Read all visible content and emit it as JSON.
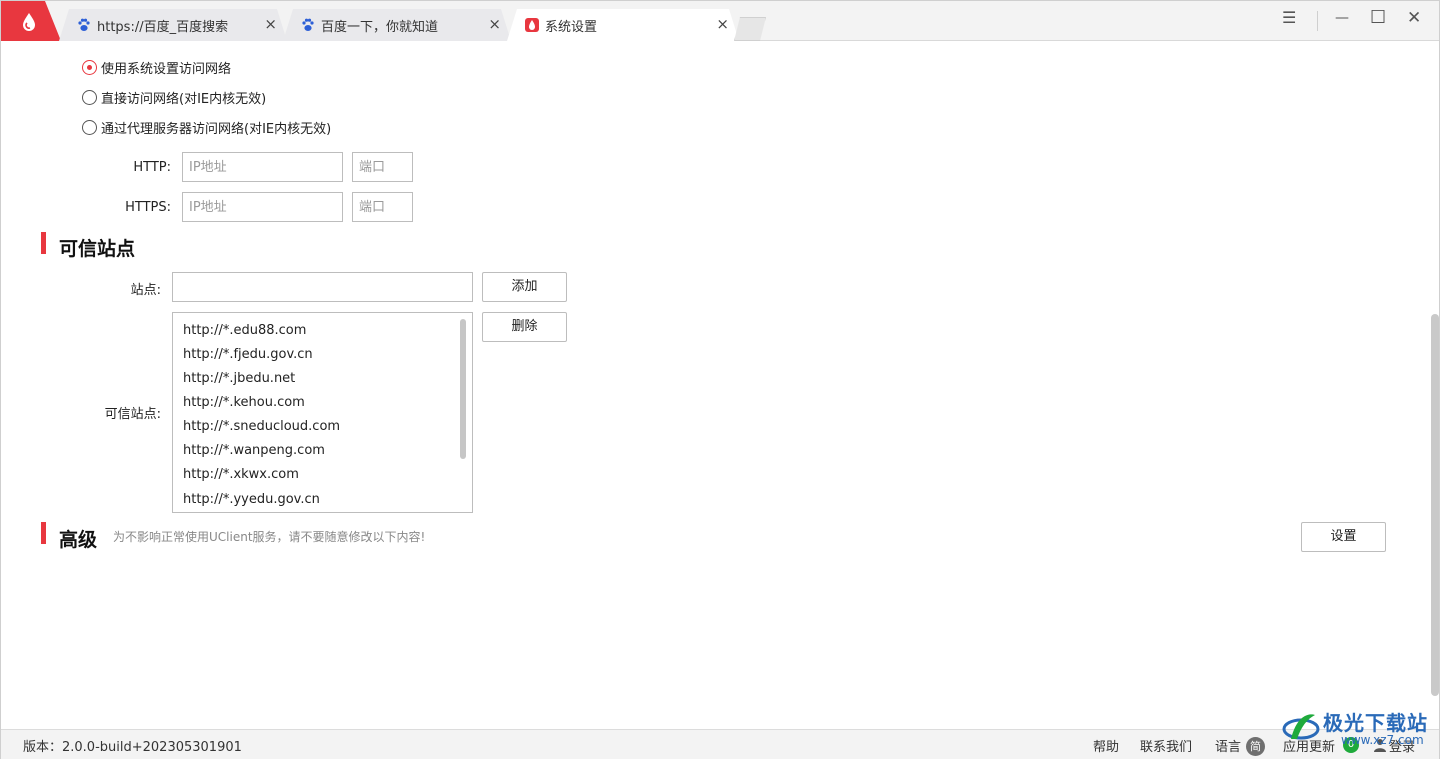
{
  "tabs": [
    {
      "title": "https://百度_百度搜索",
      "icon": "baidu-paw-icon"
    },
    {
      "title": "百度一下，你就知道",
      "icon": "baidu-paw-icon"
    },
    {
      "title": "系统设置",
      "icon": "uc-drop-icon"
    }
  ],
  "window_controls": {
    "menu": "☰",
    "minimize": "—",
    "maximize": "☐",
    "close": "✕",
    "tab_close": "×"
  },
  "network": {
    "options": [
      {
        "label": "使用系统设置访问网络",
        "checked": true
      },
      {
        "label": "直接访问网络(对IE内核无效)",
        "checked": false
      },
      {
        "label": "通过代理服务器访问网络(对IE内核无效)",
        "checked": false
      }
    ],
    "http_label": "HTTP:",
    "https_label": "HTTPS:",
    "ip_placeholder": "IP地址",
    "port_placeholder": "端口"
  },
  "trusted": {
    "title": "可信站点",
    "site_label": "站点:",
    "site_value": "",
    "add_button": "添加",
    "delete_button": "删除",
    "list_label": "可信站点:",
    "sites": [
      "http://*.edu88.com",
      "http://*.fjedu.gov.cn",
      "http://*.jbedu.net",
      "http://*.kehou.com",
      "http://*.sneducloud.com",
      "http://*.wanpeng.com",
      "http://*.xkwx.com",
      "http://*.yyedu.gov.cn"
    ]
  },
  "advanced": {
    "title": "高级",
    "note": "为不影响正常使用UClient服务，请不要随意修改以下内容!",
    "settings_button": "设置"
  },
  "status": {
    "version": "版本：2.0.0-build+202305301901",
    "help": "帮助",
    "contact": "联系我们",
    "language": "语言",
    "language_badge": "简",
    "update": "应用更新",
    "update_count": "0",
    "login": "登录"
  },
  "watermark": {
    "text": "极光下载站",
    "sub": "www.xz7.com"
  },
  "colors": {
    "accent": "#e8373f",
    "update_badge": "#1faa3c"
  }
}
